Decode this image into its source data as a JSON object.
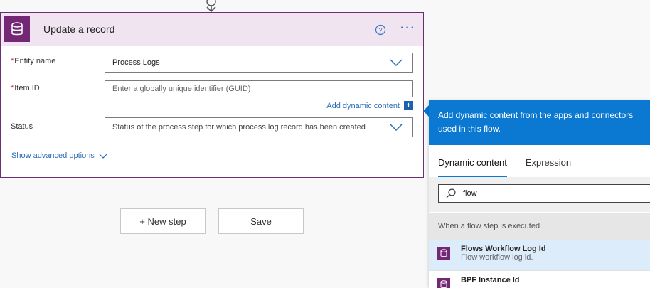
{
  "card": {
    "title": "Update a record",
    "more_label": "···",
    "fields": {
      "entity_name": {
        "label": "Entity name",
        "required": "*",
        "value": "Process Logs"
      },
      "item_id": {
        "label": "Item ID",
        "required": "*",
        "placeholder": "Enter a globally unique identifier (GUID)"
      },
      "status": {
        "label": "Status",
        "value": "Status of the process step for which process log record has been created"
      }
    },
    "add_dynamic_label": "Add dynamic content",
    "add_dynamic_badge": "+",
    "advanced_label": "Show advanced options"
  },
  "buttons": {
    "new_step": "+ New step",
    "save": "Save"
  },
  "dynamic_panel": {
    "header_line1": "Add dynamic content from the apps and connectors",
    "header_line2": "used in this flow.",
    "tabs": [
      "Dynamic content",
      "Expression"
    ],
    "search_value": "flow",
    "section_title": "When a flow step is executed",
    "items": [
      {
        "title": "Flows Workflow Log Id",
        "desc": "Flow workflow log id."
      },
      {
        "title": "BPF Instance Id",
        "desc": ""
      }
    ]
  },
  "colors": {
    "accent": "#742774",
    "link": "#2b6db6",
    "panel_header": "#0b79d1"
  },
  "icons": {
    "card_icon": "database-icon",
    "help": "help-circle-icon",
    "search": "search-icon",
    "chevron": "chevron-down-icon"
  }
}
